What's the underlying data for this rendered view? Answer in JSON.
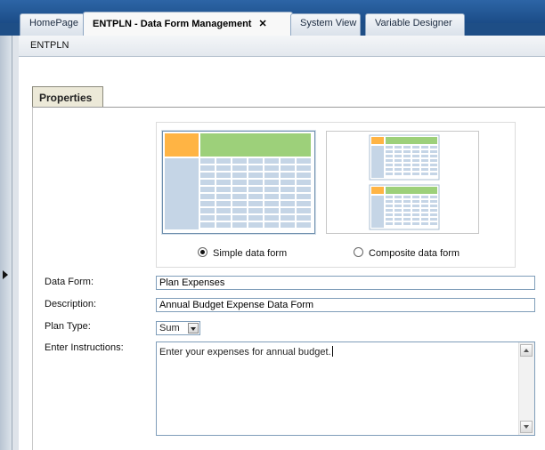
{
  "tabs": [
    {
      "label": "HomePage",
      "active": false
    },
    {
      "label": "ENTPLN - Data Form Management",
      "active": true,
      "close_icon": "close-icon"
    },
    {
      "label": "System View",
      "active": false
    },
    {
      "label": "Variable Designer",
      "active": false
    }
  ],
  "breadcrumb": "ENTPLN",
  "properties_tab": "Properties",
  "form_type": {
    "simple_label": "Simple data form",
    "composite_label": "Composite data form",
    "selected": "simple"
  },
  "fields": {
    "data_form_label": "Data Form:",
    "data_form_value": "Plan Expenses",
    "description_label": "Description:",
    "description_value": "Annual Budget Expense Data Form",
    "plan_type_label": "Plan Type:",
    "plan_type_value": "Sum",
    "instructions_label": "Enter Instructions:",
    "instructions_value": "Enter your expenses for annual budget."
  },
  "colors": {
    "header_blue": "#1e4e86",
    "grid_header_green": "#9dd07a",
    "grid_corner_orange": "#ffb444",
    "grid_cell_blue": "#c5d5e6"
  }
}
